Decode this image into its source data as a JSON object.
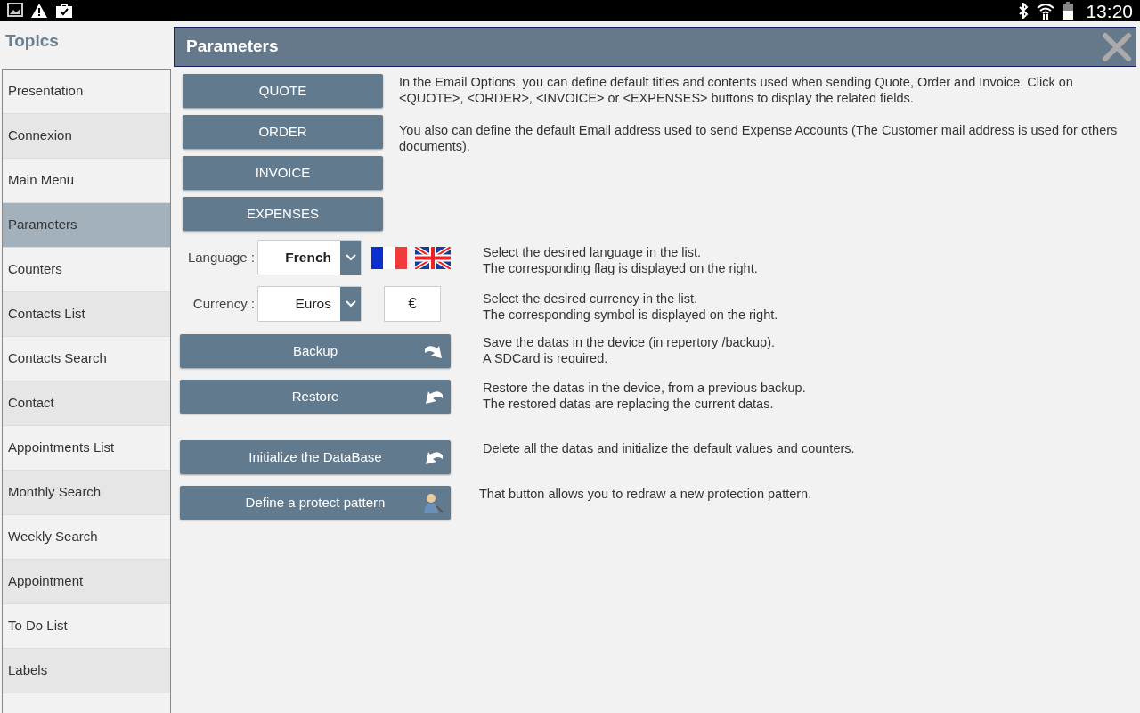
{
  "status_bar": {
    "time": "13:20"
  },
  "sidebar": {
    "title": "Topics",
    "items": [
      {
        "label": "Presentation",
        "selected": false
      },
      {
        "label": "Connexion",
        "selected": false
      },
      {
        "label": "Main Menu",
        "selected": false
      },
      {
        "label": "Parameters",
        "selected": true
      },
      {
        "label": "Counters",
        "selected": false
      },
      {
        "label": "Contacts List",
        "selected": false
      },
      {
        "label": "Contacts Search",
        "selected": false
      },
      {
        "label": "Contact",
        "selected": false
      },
      {
        "label": "Appointments List",
        "selected": false
      },
      {
        "label": "Monthly Search",
        "selected": false
      },
      {
        "label": "Weekly Search",
        "selected": false
      },
      {
        "label": "Appointment",
        "selected": false
      },
      {
        "label": "To Do List",
        "selected": false
      },
      {
        "label": "Labels",
        "selected": false
      }
    ]
  },
  "panel": {
    "title": "Parameters"
  },
  "email_buttons": [
    "QUOTE",
    "ORDER",
    "INVOICE",
    "EXPENSES"
  ],
  "intro": [
    "In the Email Options, you can define default titles and contents used when sending Quote, Order and Invoice. Click on <QUOTE>, <ORDER>, <INVOICE> or <EXPENSES> buttons to display the related fields.",
    "You also can define the default Email address used to send Expense Accounts (The Customer mail address is used for others documents)."
  ],
  "settings": [
    {
      "kind": "language",
      "label": "Language :",
      "value": "French",
      "help": [
        "Select the desired language in the list.",
        "The corresponding flag is displayed on the right."
      ]
    },
    {
      "kind": "currency",
      "label": "Currency :",
      "value": "Euros",
      "symbol": "€",
      "help": [
        "Select the desired currency in the list.",
        "The corresponding symbol is displayed on the right."
      ]
    },
    {
      "kind": "save",
      "label": "Backup",
      "help": [
        "Save the datas in the device (in repertory /backup).",
        "A SDCard is required."
      ]
    },
    {
      "kind": "restore",
      "label": "Restore",
      "help": [
        "Restore the datas in the device, from a previous backup.",
        "The restored datas are replacing the current datas."
      ]
    },
    {
      "kind": "reset",
      "label": "Initialize the DataBase",
      "help": [
        "Delete all the datas and initialize the default values and counters."
      ]
    },
    {
      "kind": "protect",
      "label": "Define a protect pattern",
      "help": [
        "That button allows you to redraw a new protection pattern."
      ]
    }
  ]
}
